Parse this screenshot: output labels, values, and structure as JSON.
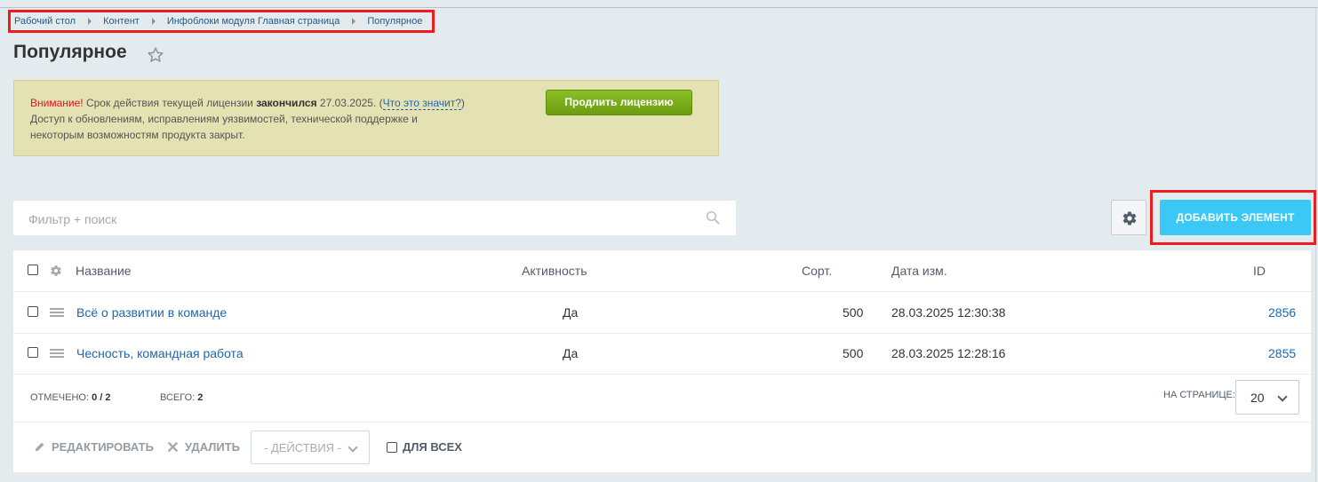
{
  "breadcrumb": [
    "Рабочий стол",
    "Контент",
    "Инфоблоки модуля Главная страница",
    "Популярное"
  ],
  "page": {
    "title": "Популярное"
  },
  "notice": {
    "warning": "Внимание!",
    "text_before": " Срок действия текущей лицензии ",
    "bold": "закончился",
    "date": " 27.03.2025. (",
    "link": "Что это значит?",
    "close_paren": ")",
    "line2": "Доступ к обновлениям, исправлениям уязвимостей, технической поддержке и",
    "line3": "некоторым возможностям продукта закрыт.",
    "button": "Продлить лицензию"
  },
  "filter": {
    "placeholder": "Фильтр + поиск"
  },
  "toolbar": {
    "add_label": "ДОБАВИТЬ ЭЛЕМЕНТ"
  },
  "table": {
    "columns": {
      "name": "Название",
      "active": "Активность",
      "sort": "Сорт.",
      "date": "Дата изм.",
      "id": "ID"
    },
    "rows": [
      {
        "name": "Всё о развитии в команде",
        "active": "Да",
        "sort": "500",
        "date": "28.03.2025 12:30:38",
        "id": "2856"
      },
      {
        "name": "Чесность, командная работа",
        "active": "Да",
        "sort": "500",
        "date": "28.03.2025 12:28:16",
        "id": "2855"
      }
    ]
  },
  "summary": {
    "selected_label": "ОТМЕЧЕНО:",
    "selected_value": "0 / 2",
    "total_label": "ВСЕГО:",
    "total_value": "2",
    "per_page_label": "НА СТРАНИЦЕ:",
    "per_page_value": "20"
  },
  "actions": {
    "edit": "РЕДАКТИРОВАТЬ",
    "delete": "УДАЛИТЬ",
    "select": "- ДЕЙСТВИЯ -",
    "for_all": "ДЛЯ ВСЕХ"
  },
  "icons": [
    "triangle-right-icon",
    "star-icon",
    "search-icon",
    "gear-icon",
    "drag-handle-icon",
    "pencil-icon",
    "cross-icon",
    "chevron-down-icon"
  ],
  "colors": {
    "accent": "#3bc8f5",
    "link": "#2067b0",
    "renew": "#7aab19",
    "warning": "#e3141b",
    "highlight": "#ee1c1c"
  }
}
